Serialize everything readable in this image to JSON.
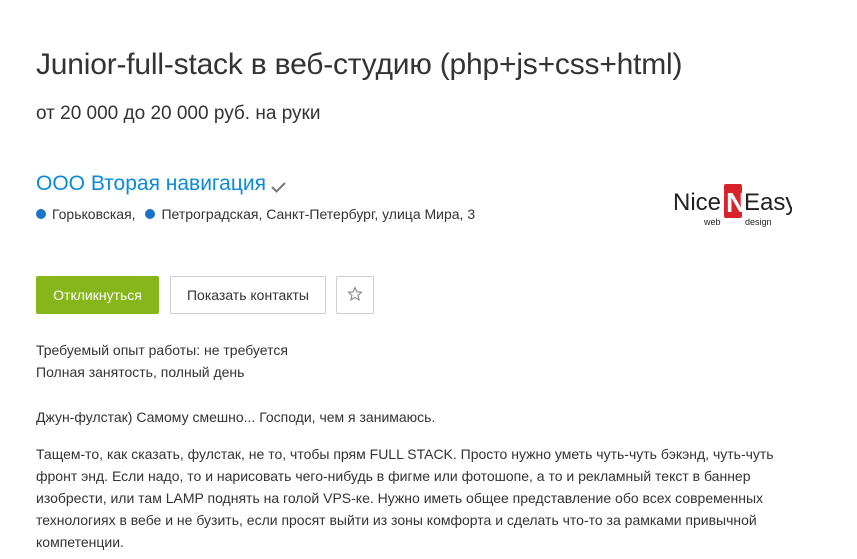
{
  "vacancy": {
    "title": "Junior-full-stack в веб-студию (php+js+css+html)",
    "salary": "от 20 000 до 20 000 руб. на руки"
  },
  "company": {
    "name": "ООО Вторая навигация",
    "metro": [
      {
        "name": "Горьковская",
        "color": "#1a73c8"
      },
      {
        "name": "Петроградская",
        "color": "#1a73c8"
      }
    ],
    "address_rest": "Санкт-Петербург, улица Мира, 3",
    "logo": {
      "part1": "Nice",
      "letter": "N",
      "part2": "Easy",
      "sub1": "web",
      "sub2": "design"
    }
  },
  "actions": {
    "respond_label": "Откликнуться",
    "contacts_label": "Показать контакты"
  },
  "conditions": {
    "experience": "Требуемый опыт работы: не требуется",
    "employment": "Полная занятость, полный день"
  },
  "description": {
    "p1": "Джун-фулстак) Самому смешно... Господи, чем я занимаюсь.",
    "p2": "Тащем-то, как сказать, фулстак, не то, чтобы прям FULL STACK. Просто нужно уметь чуть-чуть бэкэнд, чуть-чуть фронт энд. Если надо, то и нарисовать чего-нибудь в фигме или фотошопе, а то и рекламный текст в баннер изобрести, или там LAMP поднять на голой VPS-ке. Нужно иметь общее представление обо всех современных технологиях в вебе и не бузить, если просят выйти из зоны комфорта и сделать что-то за рамками привычной компетенции."
  },
  "colors": {
    "accent_link": "#0a8ad8",
    "respond_button": "#86b61a",
    "logo_red": "#d8232a"
  }
}
